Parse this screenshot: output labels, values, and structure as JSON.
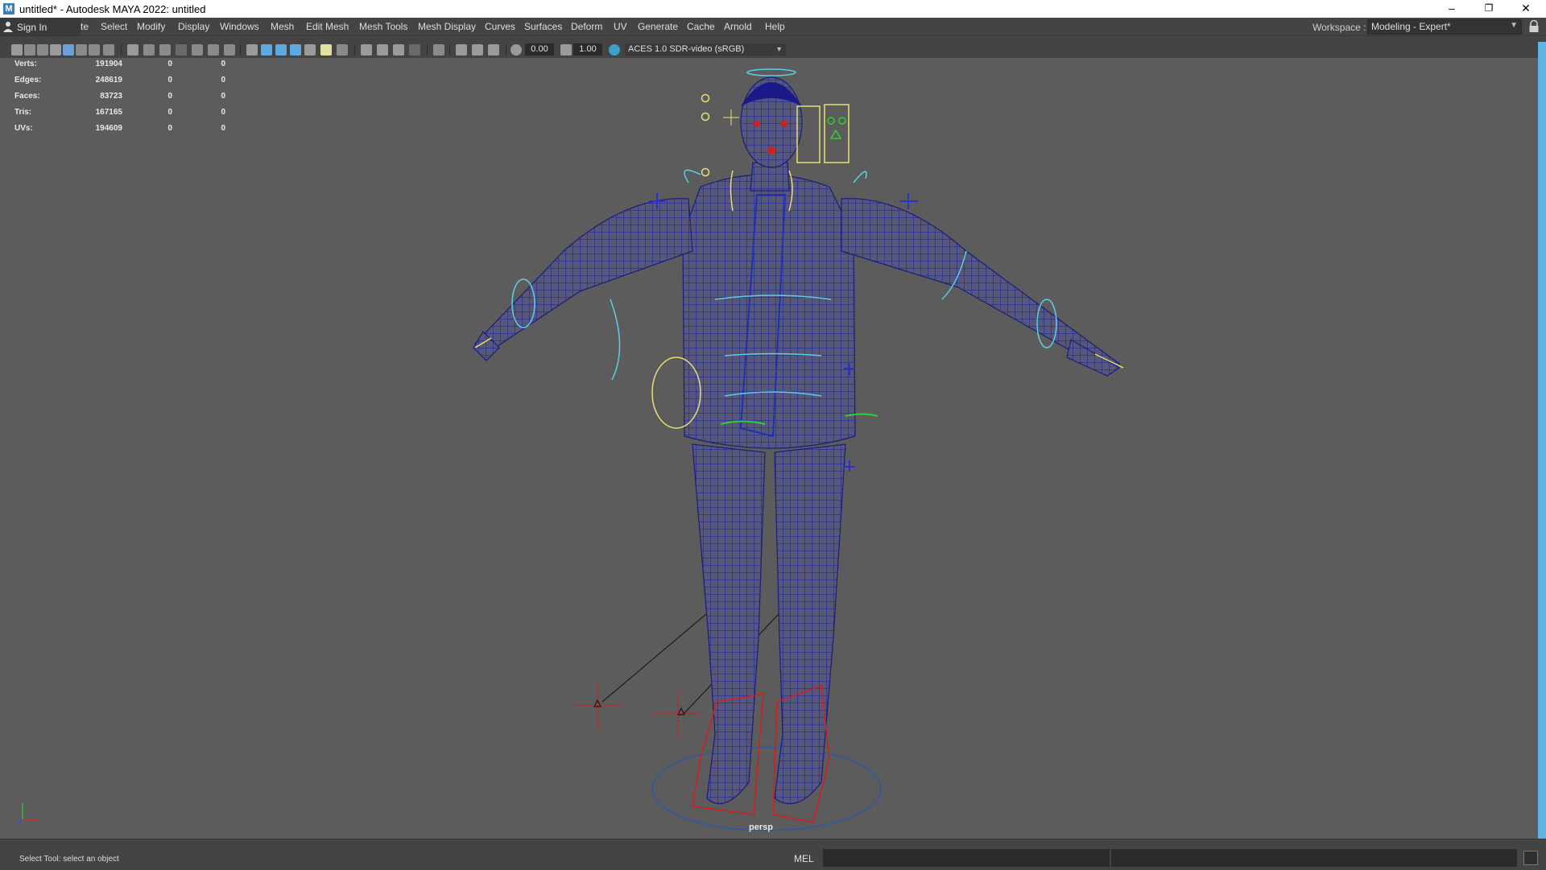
{
  "window": {
    "title": "untitled* - Autodesk MAYA 2022: untitled",
    "logo_letter": "M",
    "minimize": "–",
    "restore": "❐",
    "close": "✕"
  },
  "menubar": {
    "sign_in": "Sign In",
    "items": [
      "te",
      "Select",
      "Modify",
      "Display",
      "Windows",
      "Mesh",
      "Edit Mesh",
      "Mesh Tools",
      "Mesh Display",
      "Curves",
      "Surfaces",
      "Deform",
      "UV",
      "Generate",
      "Cache",
      "Arnold",
      "Help"
    ],
    "workspace_label": "Workspace :",
    "workspace_value": "Modeling - Expert*"
  },
  "panel_toolbar": {
    "exposure": "0.00",
    "gamma": "1.00",
    "color_space": "ACES 1.0 SDR-video (sRGB)"
  },
  "hud": {
    "rows": [
      {
        "label": "Verts:",
        "value": "191904",
        "a": "0",
        "b": "0"
      },
      {
        "label": "Edges:",
        "value": "248619",
        "a": "0",
        "b": "0"
      },
      {
        "label": "Faces:",
        "value": "83723",
        "a": "0",
        "b": "0"
      },
      {
        "label": "Tris:",
        "value": "167165",
        "a": "0",
        "b": "0"
      },
      {
        "label": "UVs:",
        "value": "194609",
        "a": "0",
        "b": "0"
      }
    ]
  },
  "viewport": {
    "camera": "persp"
  },
  "statusbar": {
    "help_line": "Select Tool: select an object",
    "command_language": "MEL"
  },
  "colors": {
    "accent": "#5fb3e0",
    "mesh_wire": "#1e2a9a",
    "controls_cyan": "#5ad0e8",
    "controls_yellow": "#e8e070",
    "controls_red": "#d02020",
    "controls_green": "#30d030"
  }
}
